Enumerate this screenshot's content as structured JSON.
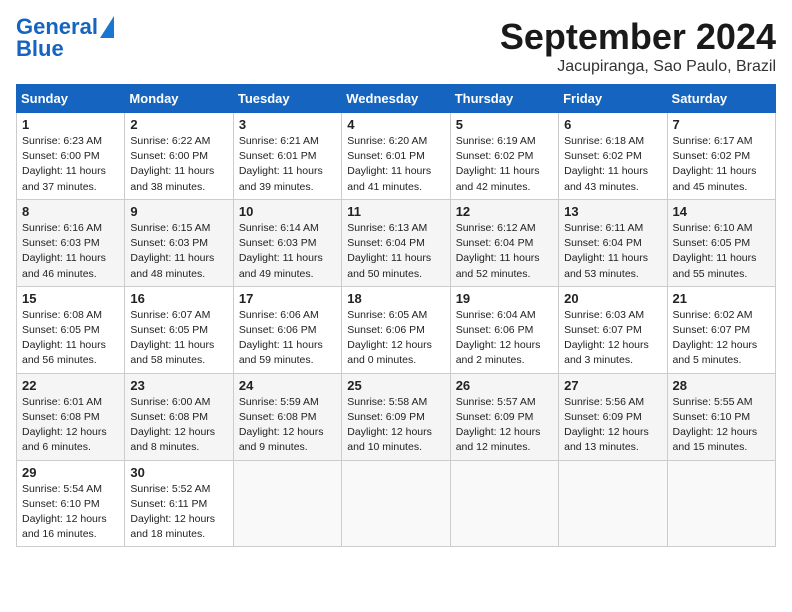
{
  "header": {
    "logo_line1": "General",
    "logo_line2": "Blue",
    "title": "September 2024",
    "subtitle": "Jacupiranga, Sao Paulo, Brazil"
  },
  "days_of_week": [
    "Sunday",
    "Monday",
    "Tuesday",
    "Wednesday",
    "Thursday",
    "Friday",
    "Saturday"
  ],
  "weeks": [
    [
      {
        "day": "1",
        "rise": "6:23 AM",
        "set": "6:00 PM",
        "daylight": "11 hours and 37 minutes."
      },
      {
        "day": "2",
        "rise": "6:22 AM",
        "set": "6:00 PM",
        "daylight": "11 hours and 38 minutes."
      },
      {
        "day": "3",
        "rise": "6:21 AM",
        "set": "6:01 PM",
        "daylight": "11 hours and 39 minutes."
      },
      {
        "day": "4",
        "rise": "6:20 AM",
        "set": "6:01 PM",
        "daylight": "11 hours and 41 minutes."
      },
      {
        "day": "5",
        "rise": "6:19 AM",
        "set": "6:02 PM",
        "daylight": "11 hours and 42 minutes."
      },
      {
        "day": "6",
        "rise": "6:18 AM",
        "set": "6:02 PM",
        "daylight": "11 hours and 43 minutes."
      },
      {
        "day": "7",
        "rise": "6:17 AM",
        "set": "6:02 PM",
        "daylight": "11 hours and 45 minutes."
      }
    ],
    [
      {
        "day": "8",
        "rise": "6:16 AM",
        "set": "6:03 PM",
        "daylight": "11 hours and 46 minutes."
      },
      {
        "day": "9",
        "rise": "6:15 AM",
        "set": "6:03 PM",
        "daylight": "11 hours and 48 minutes."
      },
      {
        "day": "10",
        "rise": "6:14 AM",
        "set": "6:03 PM",
        "daylight": "11 hours and 49 minutes."
      },
      {
        "day": "11",
        "rise": "6:13 AM",
        "set": "6:04 PM",
        "daylight": "11 hours and 50 minutes."
      },
      {
        "day": "12",
        "rise": "6:12 AM",
        "set": "6:04 PM",
        "daylight": "11 hours and 52 minutes."
      },
      {
        "day": "13",
        "rise": "6:11 AM",
        "set": "6:04 PM",
        "daylight": "11 hours and 53 minutes."
      },
      {
        "day": "14",
        "rise": "6:10 AM",
        "set": "6:05 PM",
        "daylight": "11 hours and 55 minutes."
      }
    ],
    [
      {
        "day": "15",
        "rise": "6:08 AM",
        "set": "6:05 PM",
        "daylight": "11 hours and 56 minutes."
      },
      {
        "day": "16",
        "rise": "6:07 AM",
        "set": "6:05 PM",
        "daylight": "11 hours and 58 minutes."
      },
      {
        "day": "17",
        "rise": "6:06 AM",
        "set": "6:06 PM",
        "daylight": "11 hours and 59 minutes."
      },
      {
        "day": "18",
        "rise": "6:05 AM",
        "set": "6:06 PM",
        "daylight": "12 hours and 0 minutes."
      },
      {
        "day": "19",
        "rise": "6:04 AM",
        "set": "6:06 PM",
        "daylight": "12 hours and 2 minutes."
      },
      {
        "day": "20",
        "rise": "6:03 AM",
        "set": "6:07 PM",
        "daylight": "12 hours and 3 minutes."
      },
      {
        "day": "21",
        "rise": "6:02 AM",
        "set": "6:07 PM",
        "daylight": "12 hours and 5 minutes."
      }
    ],
    [
      {
        "day": "22",
        "rise": "6:01 AM",
        "set": "6:08 PM",
        "daylight": "12 hours and 6 minutes."
      },
      {
        "day": "23",
        "rise": "6:00 AM",
        "set": "6:08 PM",
        "daylight": "12 hours and 8 minutes."
      },
      {
        "day": "24",
        "rise": "5:59 AM",
        "set": "6:08 PM",
        "daylight": "12 hours and 9 minutes."
      },
      {
        "day": "25",
        "rise": "5:58 AM",
        "set": "6:09 PM",
        "daylight": "12 hours and 10 minutes."
      },
      {
        "day": "26",
        "rise": "5:57 AM",
        "set": "6:09 PM",
        "daylight": "12 hours and 12 minutes."
      },
      {
        "day": "27",
        "rise": "5:56 AM",
        "set": "6:09 PM",
        "daylight": "12 hours and 13 minutes."
      },
      {
        "day": "28",
        "rise": "5:55 AM",
        "set": "6:10 PM",
        "daylight": "12 hours and 15 minutes."
      }
    ],
    [
      {
        "day": "29",
        "rise": "5:54 AM",
        "set": "6:10 PM",
        "daylight": "12 hours and 16 minutes."
      },
      {
        "day": "30",
        "rise": "5:52 AM",
        "set": "6:11 PM",
        "daylight": "12 hours and 18 minutes."
      },
      null,
      null,
      null,
      null,
      null
    ]
  ]
}
